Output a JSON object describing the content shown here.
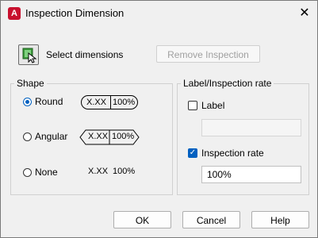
{
  "window": {
    "title": "Inspection Dimension",
    "app_icon_letter": "A"
  },
  "toolbar": {
    "select_label": "Select dimensions",
    "remove_label": "Remove Inspection"
  },
  "shape": {
    "group_label": "Shape",
    "options": [
      {
        "label": "Round",
        "checked": true,
        "sample_value": "X.XX",
        "sample_rate": "100%"
      },
      {
        "label": "Angular",
        "checked": false,
        "sample_value": "X.XX",
        "sample_rate": "100%"
      },
      {
        "label": "None",
        "checked": false,
        "sample_value": "X.XX",
        "sample_rate": "100%"
      }
    ]
  },
  "label_rate": {
    "group_label": "Label/Inspection rate",
    "label_checkbox": {
      "label": "Label",
      "checked": false,
      "value": ""
    },
    "rate_checkbox": {
      "label": "Inspection rate",
      "checked": true,
      "value": "100%"
    }
  },
  "footer": {
    "ok_label": "OK",
    "cancel_label": "Cancel",
    "help_label": "Help"
  },
  "colors": {
    "accent": "#0060c0",
    "app_icon": "#c8102e"
  }
}
